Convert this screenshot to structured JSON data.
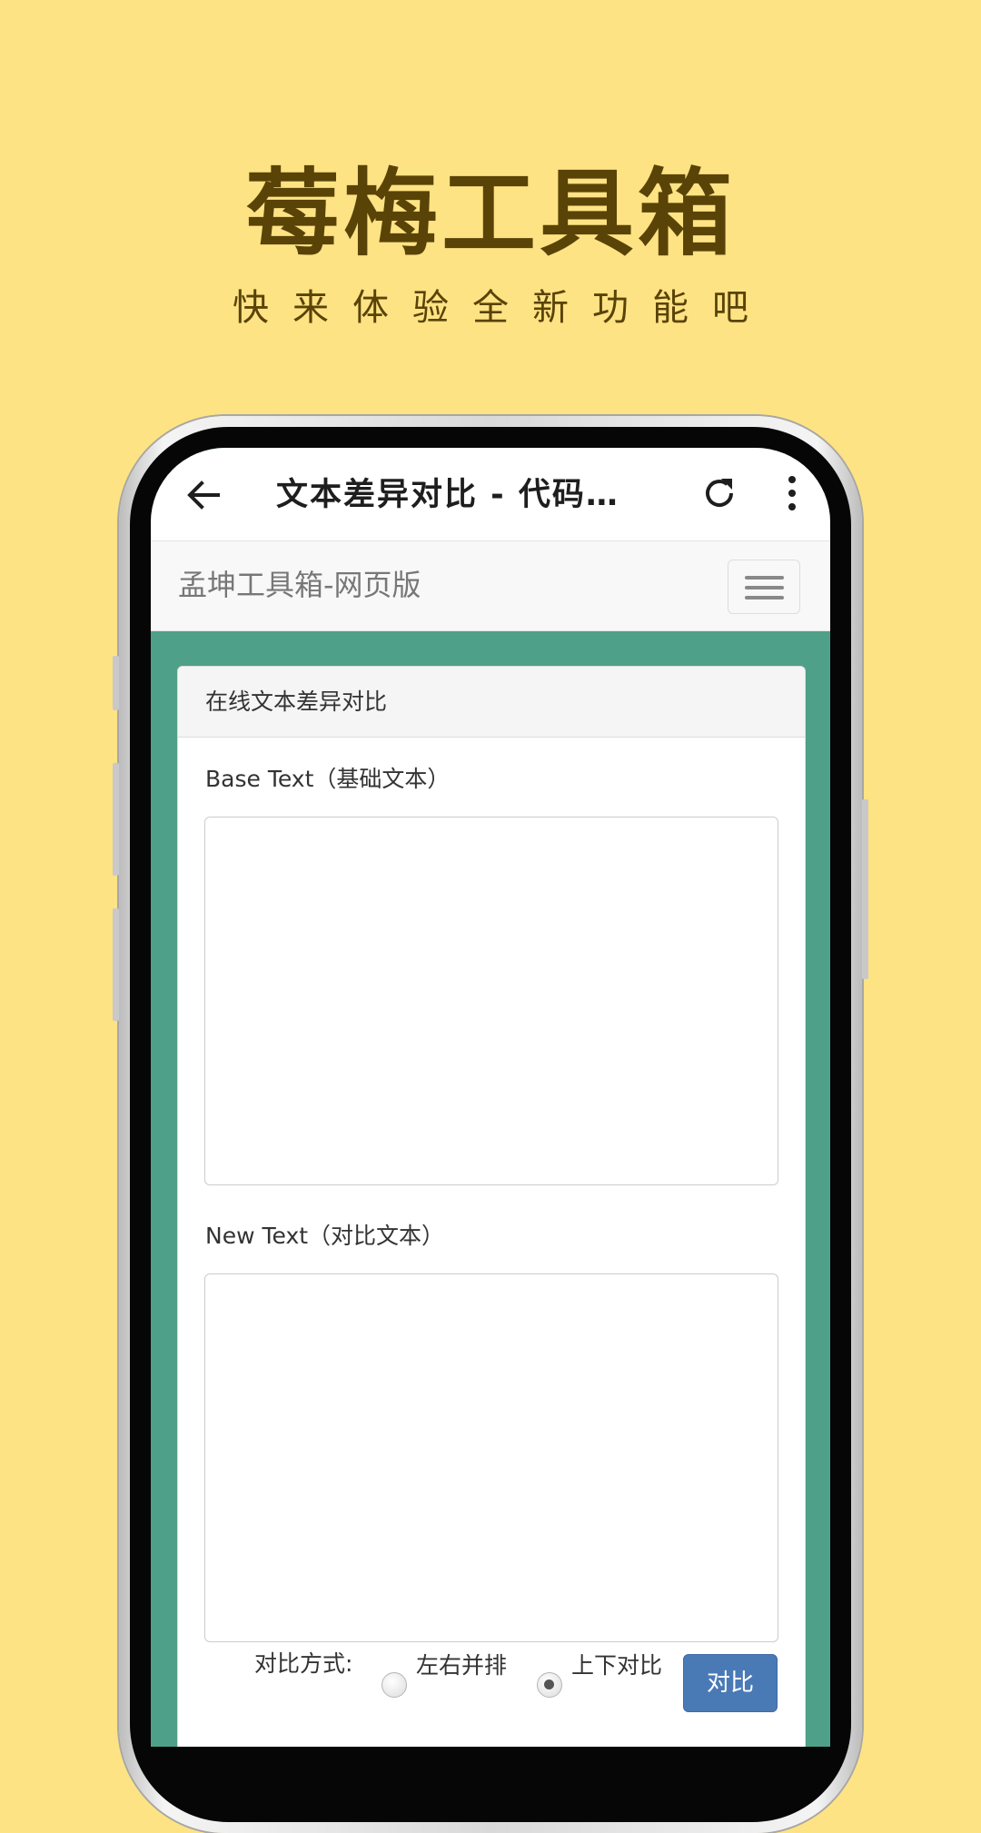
{
  "promo": {
    "title": "莓梅工具箱",
    "subtitle": "快来体验全新功能吧"
  },
  "appbar": {
    "title": "文本差异对比 - 代码…",
    "back_icon": "arrow-left-icon",
    "refresh_icon": "refresh-icon",
    "more_icon": "more-vertical-icon"
  },
  "navbar": {
    "brand": "孟坤工具箱-网页版",
    "toggle_icon": "hamburger-menu-icon"
  },
  "panel": {
    "heading": "在线文本差异对比",
    "base_label": "Base Text（基础文本）",
    "base_value": "",
    "new_label": "New Text（对比文本）",
    "new_value": "",
    "mode_label": "对比方式:",
    "mode_options": [
      "左右并排",
      "上下对比"
    ],
    "mode_selected": "上下对比",
    "compare_button": "对比"
  },
  "colors": {
    "background": "#fee384",
    "promo_text": "#5a4307",
    "page_green": "#4fa088",
    "button_blue": "#4a7ab6"
  }
}
